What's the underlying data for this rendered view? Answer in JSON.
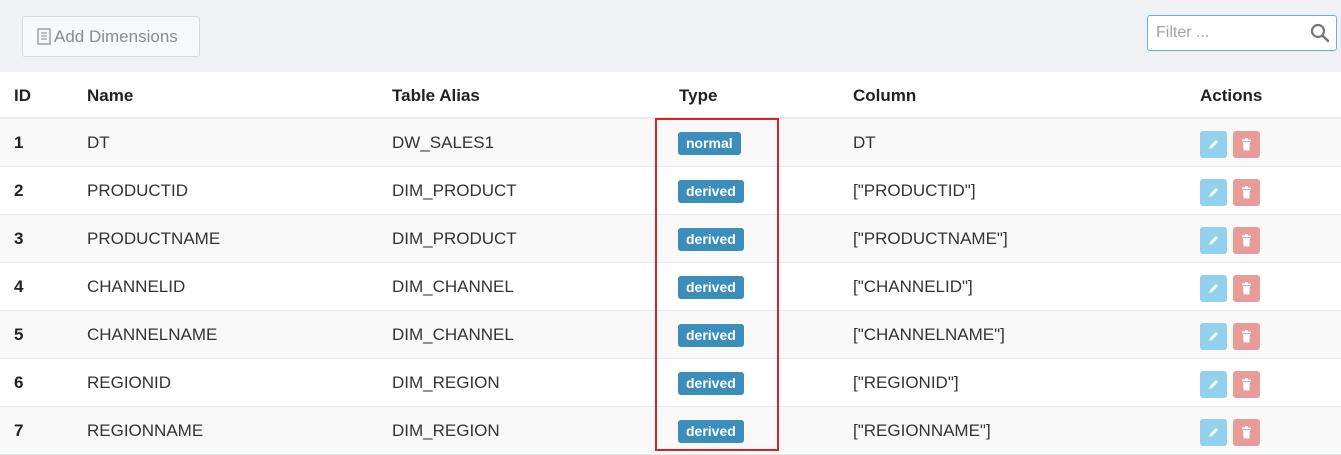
{
  "toolbar": {
    "add_button_label": "Add Dimensions",
    "filter_placeholder": "Filter ..."
  },
  "table": {
    "headers": {
      "id": "ID",
      "name": "Name",
      "table_alias": "Table Alias",
      "type": "Type",
      "column": "Column",
      "actions": "Actions"
    },
    "rows": [
      {
        "id": "1",
        "name": "DT",
        "table_alias": "DW_SALES1",
        "type": "normal",
        "column": "DT"
      },
      {
        "id": "2",
        "name": "PRODUCTID",
        "table_alias": "DIM_PRODUCT",
        "type": "derived",
        "column": "[\"PRODUCTID\"]"
      },
      {
        "id": "3",
        "name": "PRODUCTNAME",
        "table_alias": "DIM_PRODUCT",
        "type": "derived",
        "column": "[\"PRODUCTNAME\"]"
      },
      {
        "id": "4",
        "name": "CHANNELID",
        "table_alias": "DIM_CHANNEL",
        "type": "derived",
        "column": "[\"CHANNELID\"]"
      },
      {
        "id": "5",
        "name": "CHANNELNAME",
        "table_alias": "DIM_CHANNEL",
        "type": "derived",
        "column": "[\"CHANNELNAME\"]"
      },
      {
        "id": "6",
        "name": "REGIONID",
        "table_alias": "DIM_REGION",
        "type": "derived",
        "column": "[\"REGIONID\"]"
      },
      {
        "id": "7",
        "name": "REGIONNAME",
        "table_alias": "DIM_REGION",
        "type": "derived",
        "column": "[\"REGIONNAME\"]"
      }
    ]
  },
  "colors": {
    "badge": "#3c8dbc",
    "edit_button": "#91d1ec",
    "delete_button": "#e89b9b",
    "highlight": "#d9212a"
  }
}
